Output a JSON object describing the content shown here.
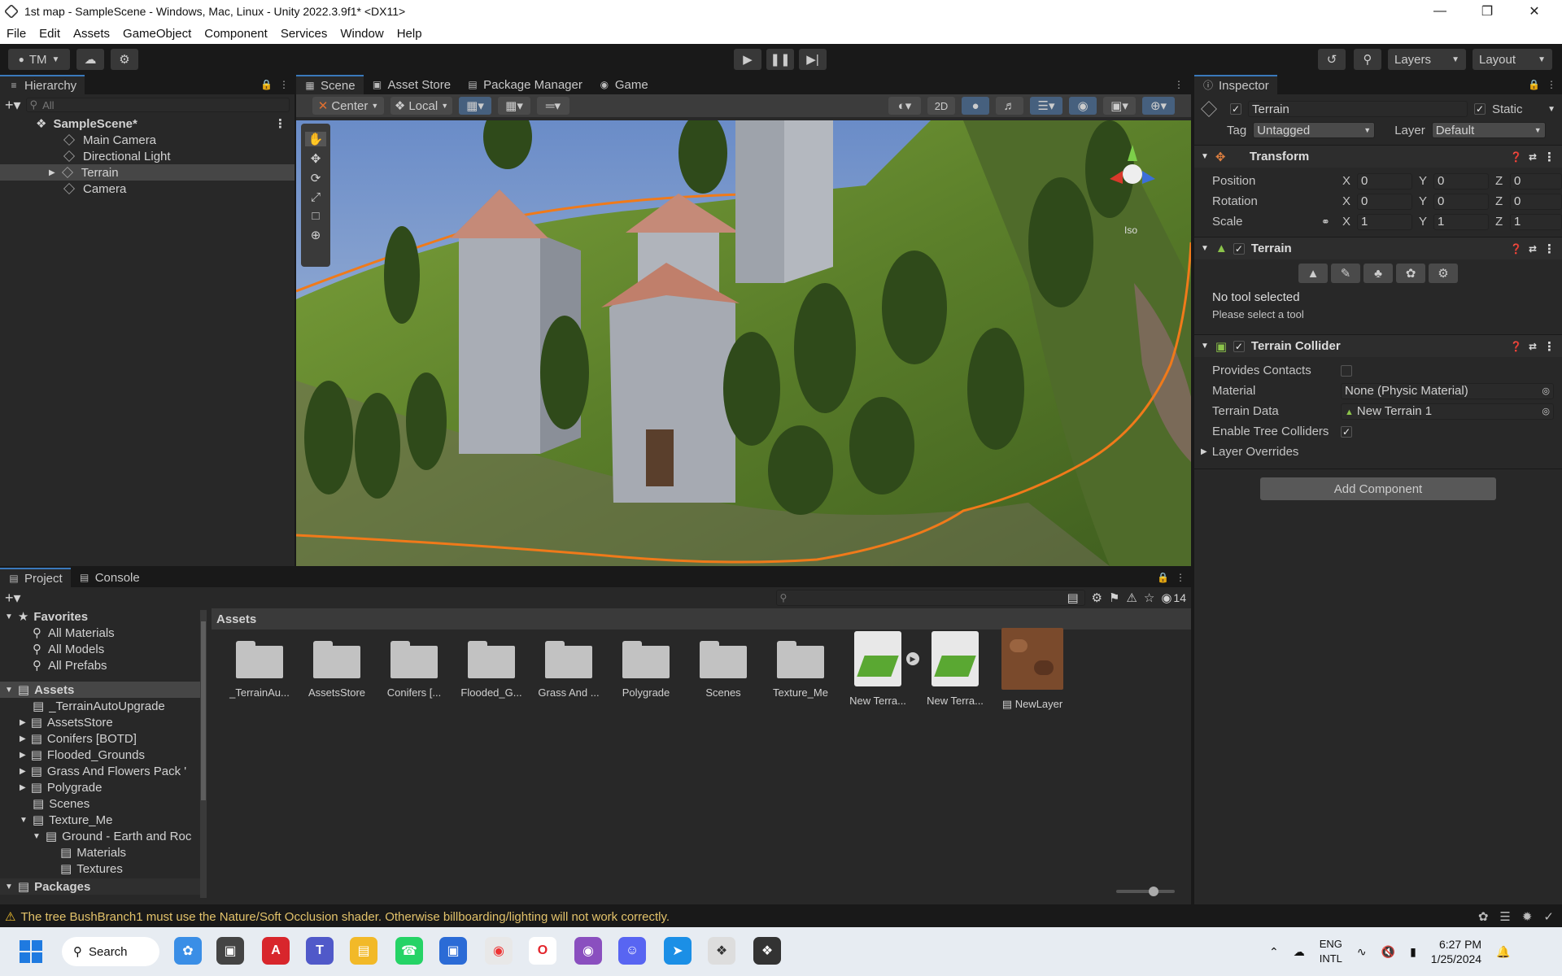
{
  "window": {
    "title": "1st map - SampleScene - Windows, Mac, Linux - Unity 2022.3.9f1* <DX11>"
  },
  "menu": [
    "File",
    "Edit",
    "Assets",
    "GameObject",
    "Component",
    "Services",
    "Window",
    "Help"
  ],
  "toolbar": {
    "account": "TM",
    "layers": "Layers",
    "layout": "Layout"
  },
  "hierarchy": {
    "tab": "Hierarchy",
    "search_placeholder": "All",
    "scene": "SampleScene*",
    "items": [
      "Main Camera",
      "Directional Light",
      "Terrain",
      "Camera"
    ]
  },
  "scene_view": {
    "tabs": [
      "Scene",
      "Asset Store",
      "Package Manager",
      "Game"
    ],
    "pivot": "Center",
    "space": "Local",
    "mode_2d": "2D",
    "persp": "Iso"
  },
  "inspector": {
    "tab": "Inspector",
    "object_name": "Terrain",
    "static_label": "Static",
    "tag_label": "Tag",
    "tag_value": "Untagged",
    "layer_label": "Layer",
    "layer_value": "Default",
    "transform": {
      "title": "Transform",
      "rows": [
        {
          "label": "Position",
          "x": "0",
          "y": "0",
          "z": "0"
        },
        {
          "label": "Rotation",
          "x": "0",
          "y": "0",
          "z": "0"
        },
        {
          "label": "Scale",
          "x": "1",
          "y": "1",
          "z": "1"
        }
      ]
    },
    "terrain": {
      "title": "Terrain",
      "no_tool": "No tool selected",
      "hint": "Please select a tool"
    },
    "collider": {
      "title": "Terrain Collider",
      "provides_contacts": "Provides Contacts",
      "material_label": "Material",
      "material_value": "None (Physic Material)",
      "data_label": "Terrain Data",
      "data_value": "New Terrain 1",
      "tree_colliders": "Enable Tree Colliders",
      "overrides": "Layer Overrides"
    },
    "add_component": "Add Component"
  },
  "project": {
    "tabs": [
      "Project",
      "Console"
    ],
    "hidden_count": "14",
    "breadcrumb": "Assets",
    "favorites_label": "Favorites",
    "favorites": [
      "All Materials",
      "All Models",
      "All Prefabs"
    ],
    "assets_label": "Assets",
    "tree": [
      "_TerrainAutoUpgrade",
      "AssetsStore",
      "Conifers [BOTD]",
      "Flooded_Grounds",
      "Grass And Flowers Pack '",
      "Polygrade",
      "Scenes",
      "Texture_Me",
      "Ground - Earth and Roc",
      "Materials",
      "Textures"
    ],
    "packages_label": "Packages",
    "grid": [
      "_TerrainAu...",
      "AssetsStore",
      "Conifers [...",
      "Flooded_G...",
      "Grass And ...",
      "Polygrade",
      "Scenes",
      "Texture_Me",
      "New Terra...",
      "New Terra...",
      "NewLayer"
    ]
  },
  "status": {
    "warning": "The tree BushBranch1 must use the Nature/Soft Occlusion shader. Otherwise billboarding/lighting will not work correctly."
  },
  "taskbar": {
    "search": "Search",
    "lang1": "ENG",
    "lang2": "INTL",
    "time": "6:27 PM",
    "date": "1/25/2024"
  }
}
